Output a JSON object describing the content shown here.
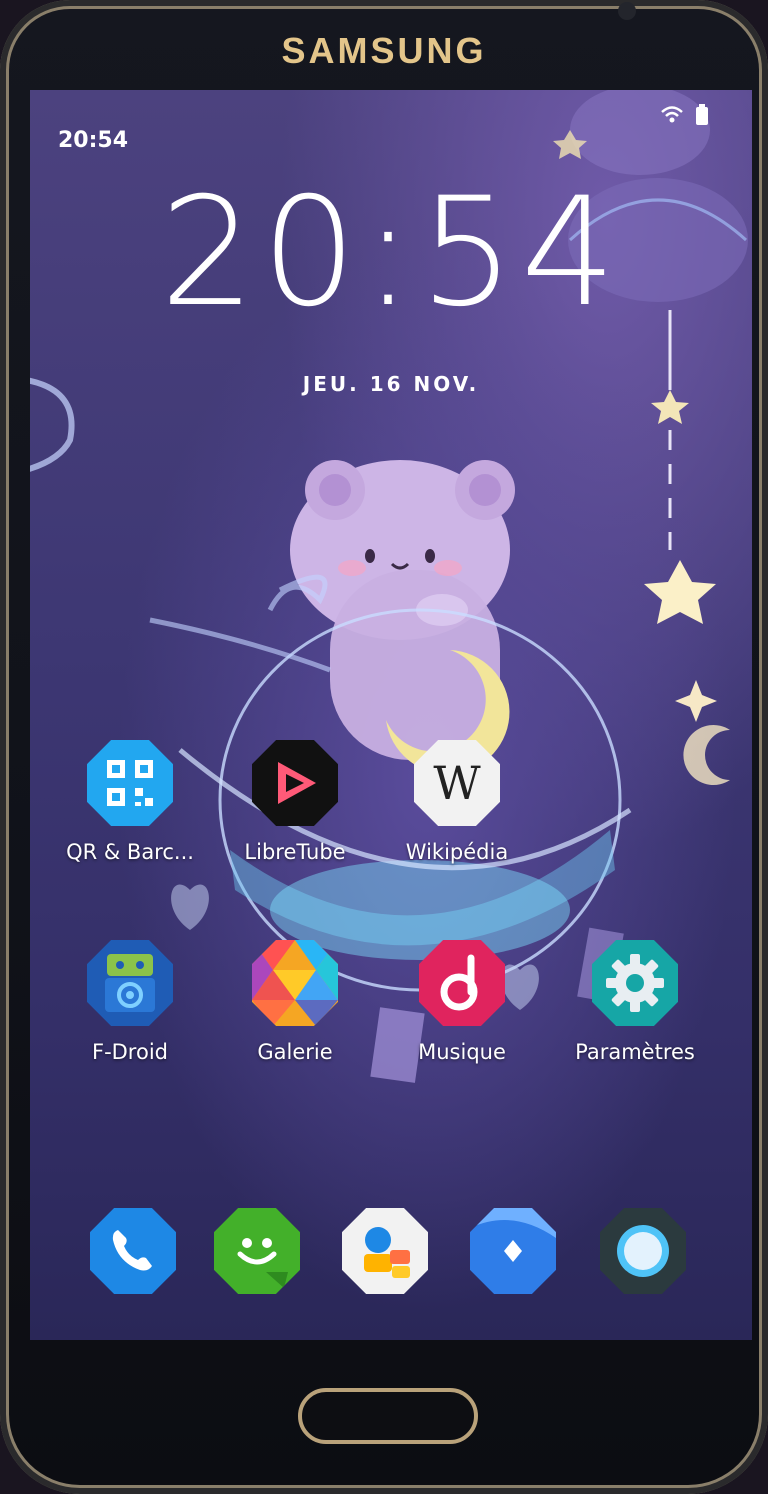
{
  "device": {
    "brand": "SAMSUNG"
  },
  "status_bar": {
    "time": "20:54",
    "icons": [
      "wifi-icon",
      "battery-icon"
    ]
  },
  "lockclock": {
    "time": "20:54",
    "date": "JEU. 16 NOV."
  },
  "apps": [
    {
      "name": "qr-barcode",
      "label": "QR & Barc...",
      "icon": "qr-code-icon"
    },
    {
      "name": "libretube",
      "label": "LibreTube",
      "icon": "play-triangle-icon"
    },
    {
      "name": "wikipedia",
      "label": "Wikipédia",
      "icon": "wikipedia-w-icon",
      "glyph": "W"
    },
    {
      "name": "f-droid",
      "label": "F-Droid",
      "icon": "android-robot-icon"
    },
    {
      "name": "galerie",
      "label": "Galerie",
      "icon": "gallery-mosaic-icon"
    },
    {
      "name": "musique",
      "label": "Musique",
      "icon": "music-note-icon"
    },
    {
      "name": "parametres",
      "label": "Paramètres",
      "icon": "gear-icon"
    }
  ],
  "dock": [
    {
      "name": "phone",
      "icon": "phone-icon"
    },
    {
      "name": "messages",
      "icon": "messages-icon"
    },
    {
      "name": "contacts",
      "icon": "contacts-icon"
    },
    {
      "name": "browser",
      "icon": "compass-icon"
    },
    {
      "name": "camera",
      "icon": "camera-icon"
    }
  ],
  "colors": {
    "qr": "#22a7f0",
    "libretube_bg": "#111111",
    "libretube_accent": "#ff5a78",
    "wikipedia_bg": "#f2f2f2",
    "fdroid": "#1f5cb5",
    "fdroid_robot": "#8bc34a",
    "musique": "#e0245e",
    "parametres": "#16a6a6",
    "phone": "#1e88e5",
    "messages": "#43b02a",
    "browser": "#2f7de8",
    "camera": "#2b3a3e"
  }
}
